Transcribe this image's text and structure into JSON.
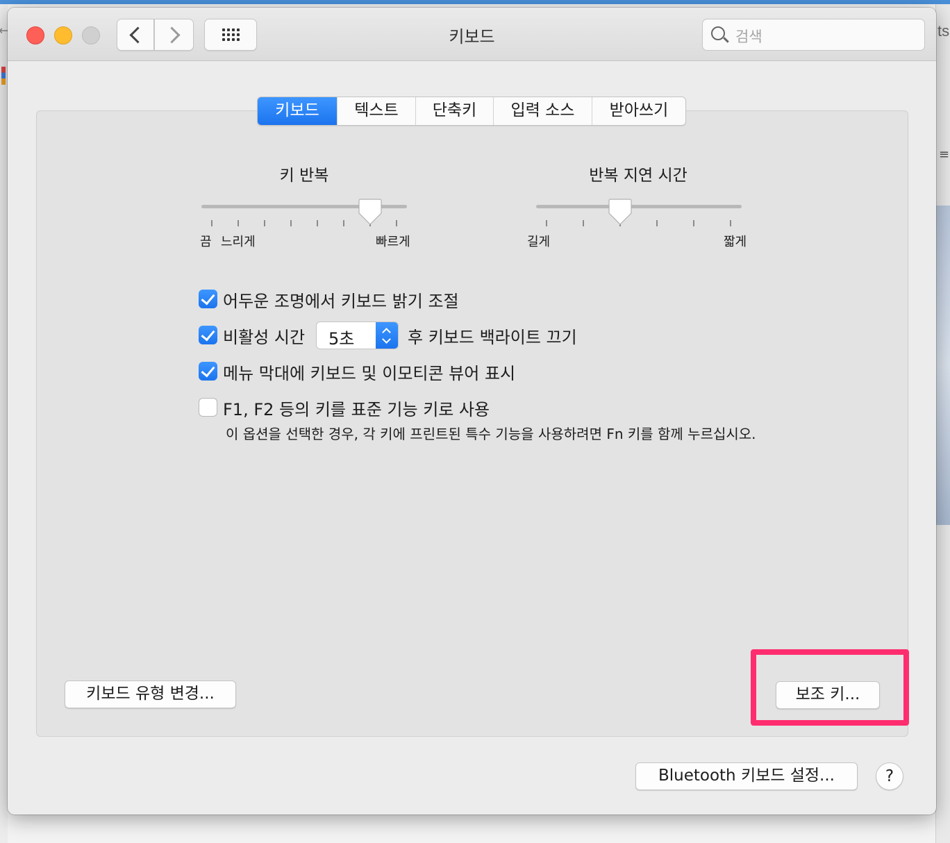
{
  "window": {
    "title": "키보드"
  },
  "toolbar": {
    "search_placeholder": "검색"
  },
  "tabs": [
    {
      "label": "키보드",
      "active": true
    },
    {
      "label": "텍스트",
      "active": false
    },
    {
      "label": "단축키",
      "active": false
    },
    {
      "label": "입력 소스",
      "active": false
    },
    {
      "label": "받아쓰기",
      "active": false
    }
  ],
  "key_repeat": {
    "title": "키 반복",
    "label_off": "끔",
    "label_slow": "느리게",
    "label_fast": "빠르게",
    "stops": 8,
    "selected_stop": 7
  },
  "repeat_delay": {
    "title": "반복 지연 시간",
    "label_long": "길게",
    "label_short": "짧게",
    "stops": 6,
    "selected_stop": 3
  },
  "options": {
    "adjust_brightness": {
      "label": "어두운 조명에서 키보드 밝기 조절",
      "checked": true
    },
    "backlight_off": {
      "label_before": "비활성 시간",
      "value": "5초",
      "label_after": "후 키보드 백라이트 끄기",
      "checked": true
    },
    "menu_bar_viewer": {
      "label": "메뉴 막대에 키보드 및 이모티콘 뷰어 표시",
      "checked": true
    },
    "fn_keys": {
      "label": "F1, F2 등의 키를 표준 기능 키로 사용",
      "checked": false,
      "note": "이 옵션을 선택한 경우, 각 키에 프린트된 특수 기능을 사용하려면 Fn 키를 함께 누르십시오."
    }
  },
  "buttons": {
    "change_type": "키보드 유형 변경...",
    "modifier_keys": "보조 키...",
    "bluetooth": "Bluetooth 키보드 설정...",
    "help": "?"
  },
  "colors": {
    "accent": "#1c74ee",
    "highlight": "#ff2d6f"
  },
  "background": {
    "right_peek_text": "ts"
  }
}
